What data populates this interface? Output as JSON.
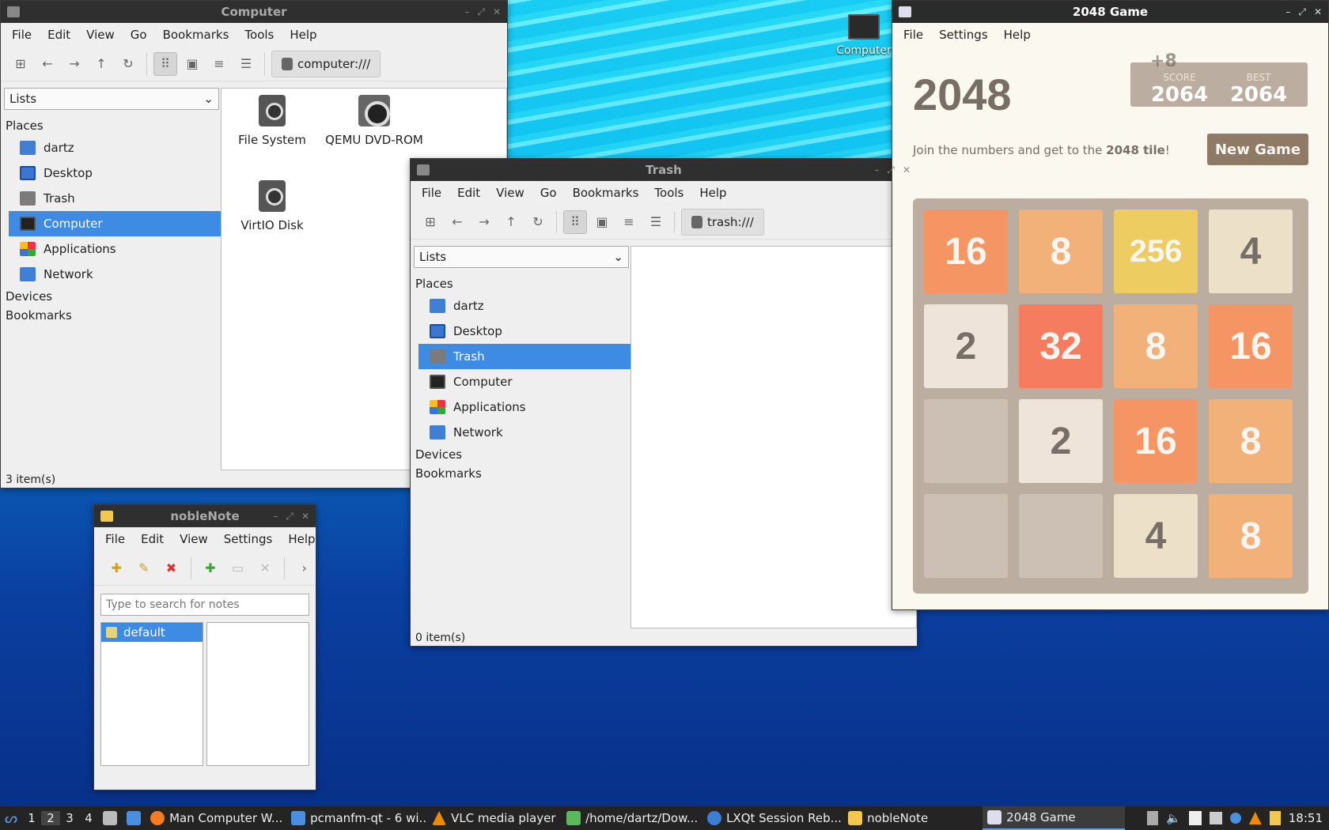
{
  "desktop": {
    "icon_label": "Computer"
  },
  "menus": {
    "fm": [
      "File",
      "Edit",
      "View",
      "Go",
      "Bookmarks",
      "Tools",
      "Help"
    ],
    "note": [
      "File",
      "Edit",
      "View",
      "Settings",
      "Help"
    ],
    "game": [
      "File",
      "Settings",
      "Help"
    ]
  },
  "computer_win": {
    "title": "Computer",
    "path": "computer:///",
    "view_combo": "Lists",
    "places_header": "Places",
    "places": [
      "dartz",
      "Desktop",
      "Trash",
      "Computer",
      "Applications",
      "Network"
    ],
    "devices_header": "Devices",
    "bookmarks_header": "Bookmarks",
    "files": [
      "File System",
      "QEMU DVD-ROM",
      "VirtIO Disk"
    ],
    "status": "3 item(s)"
  },
  "trash_win": {
    "title": "Trash",
    "path": "trash:///",
    "view_combo": "Lists",
    "places_header": "Places",
    "places": [
      "dartz",
      "Desktop",
      "Trash",
      "Computer",
      "Applications",
      "Network"
    ],
    "devices_header": "Devices",
    "bookmarks_header": "Bookmarks",
    "status": "0 item(s)"
  },
  "note_win": {
    "title": "nobleNote",
    "search_placeholder": "Type to search for notes",
    "folder": "default"
  },
  "game_win": {
    "title": "2048 Game",
    "heading": "2048",
    "score_label": "SCORE",
    "score": "2064",
    "best_label": "BEST",
    "best": "2064",
    "score_delta": "+8",
    "intro_pre": "Join the numbers and get to the ",
    "intro_bold": "2048 tile",
    "intro_post": "!",
    "new_game": "New Game",
    "rows": [
      [
        "16",
        "8",
        "256",
        "4"
      ],
      [
        "2",
        "32",
        "8",
        "16"
      ],
      [
        "",
        "2",
        "16",
        "8"
      ],
      [
        "",
        "",
        "4",
        "8"
      ]
    ]
  },
  "taskbar": {
    "workspaces": [
      "1",
      "2",
      "3",
      "4"
    ],
    "current_workspace": "2",
    "tasks": [
      "Man Computer W...",
      "pcmanfm-qt - 6 wi...",
      "VLC media player",
      "/home/dartz/Dow...",
      "LXQt Session Reb...",
      "nobleNote",
      "2048 Game"
    ],
    "clock": "18:51"
  },
  "colors": {
    "selection": "#3d8be3",
    "game_bg": "#faf8ef",
    "board": "#bbada0"
  }
}
